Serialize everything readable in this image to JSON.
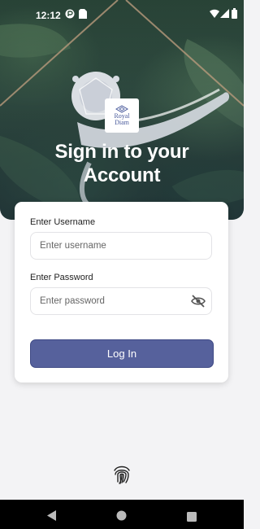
{
  "status_bar": {
    "time": "12:12",
    "icons": [
      "photo-icon",
      "sim-card-icon",
      "wifi-icon",
      "signal-icon",
      "battery-icon"
    ]
  },
  "hero": {
    "logo_line1": "Royal",
    "logo_line2": "Diam",
    "title_line1": "Sign in to your",
    "title_line2": "Account"
  },
  "form": {
    "username_label": "Enter Username",
    "username_placeholder": "Enter username",
    "username_value": "",
    "password_label": "Enter Password",
    "password_placeholder": "Enter password",
    "password_value": "",
    "login_label": "Log In"
  },
  "colors": {
    "accent": "#56619c",
    "background": "#f3f3f5",
    "logo": "#4a5b9c"
  },
  "nav_bar": {
    "buttons": [
      "back-icon",
      "home-icon",
      "recents-icon"
    ]
  }
}
